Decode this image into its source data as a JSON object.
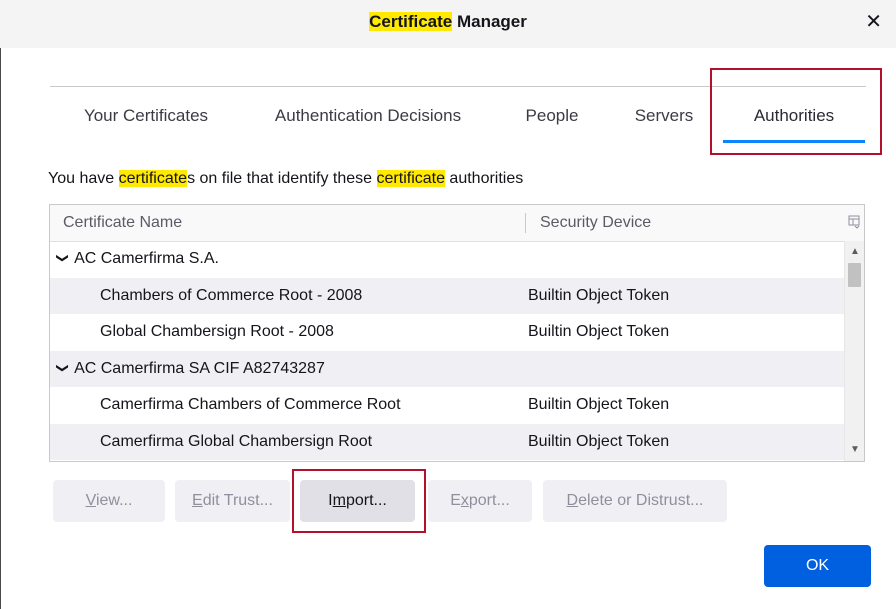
{
  "dialog": {
    "title_highlight": "Certificate",
    "title_rest": " Manager",
    "close_glyph": "✕"
  },
  "tabs": [
    {
      "label": "Your Certificates",
      "active": false
    },
    {
      "label": "Authentication Decisions",
      "active": false
    },
    {
      "label": "People",
      "active": false
    },
    {
      "label": "Servers",
      "active": false
    },
    {
      "label": "Authorities",
      "active": true
    }
  ],
  "description": {
    "part1": "You have ",
    "hl1": "certificate",
    "part2": "s on file that identify these ",
    "hl2": "certificate",
    "part3": " authorities"
  },
  "table": {
    "columns": [
      "Certificate Name",
      "Security Device"
    ],
    "rows": [
      {
        "type": "group",
        "name": "AC Camerfirma S.A.",
        "device": ""
      },
      {
        "type": "item",
        "name": "Chambers of Commerce Root - 2008",
        "device": "Builtin Object Token"
      },
      {
        "type": "item",
        "name": "Global Chambersign Root - 2008",
        "device": "Builtin Object Token"
      },
      {
        "type": "group",
        "name": "AC Camerfirma SA CIF A82743287",
        "device": ""
      },
      {
        "type": "item",
        "name": "Camerfirma Chambers of Commerce Root",
        "device": "Builtin Object Token"
      },
      {
        "type": "item",
        "name": "Camerfirma Global Chambersign Root",
        "device": "Builtin Object Token"
      }
    ]
  },
  "buttons": {
    "view": {
      "accel": "V",
      "rest": "iew..."
    },
    "edit_trust": {
      "accel": "E",
      "rest": "dit Trust..."
    },
    "import": {
      "pre": "I",
      "accel": "m",
      "rest": "port..."
    },
    "export": {
      "pre": "E",
      "accel": "x",
      "rest": "port..."
    },
    "delete": {
      "accel": "D",
      "rest": "elete or Distrust..."
    },
    "ok": "OK"
  },
  "colors": {
    "accent": "#0a84ff",
    "ok_button": "#0060df",
    "search_highlight": "#ffe900",
    "annotation_box": "#b2112b"
  }
}
